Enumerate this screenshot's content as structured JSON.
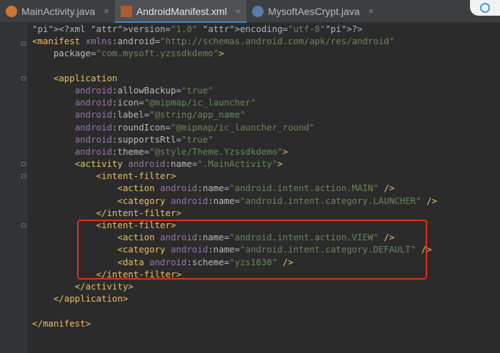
{
  "tabs": [
    {
      "label": "MainActivity.java",
      "icon": "java-file-icon",
      "active": false
    },
    {
      "label": "AndroidManifest.xml",
      "icon": "xml-file-icon",
      "active": true
    },
    {
      "label": "MysoftAesCrypt.java",
      "icon": "java-file-icon",
      "active": false
    }
  ],
  "tab_close_glyph": "×",
  "code_lines": [
    {
      "indent": 0,
      "text": "<?xml version=\"1.0\" encoding=\"utf-8\"?>"
    },
    {
      "indent": 0,
      "text": "<manifest xmlns:android=\"http://schemas.android.com/apk/res/android\""
    },
    {
      "indent": 4,
      "text": "package=\"com.mysoft.yzssdkdemo\">"
    },
    {
      "indent": 0,
      "text": ""
    },
    {
      "indent": 4,
      "text": "<application"
    },
    {
      "indent": 8,
      "text": "android:allowBackup=\"true\""
    },
    {
      "indent": 8,
      "text": "android:icon=\"@mipmap/ic_launcher\""
    },
    {
      "indent": 8,
      "text": "android:label=\"@string/app_name\""
    },
    {
      "indent": 8,
      "text": "android:roundIcon=\"@mipmap/ic_launcher_round\""
    },
    {
      "indent": 8,
      "text": "android:supportsRtl=\"true\""
    },
    {
      "indent": 8,
      "text": "android:theme=\"@style/Theme.Yzssdkdemo\">"
    },
    {
      "indent": 8,
      "text": "<activity android:name=\".MainActivity\">"
    },
    {
      "indent": 12,
      "text": "<intent-filter>"
    },
    {
      "indent": 16,
      "text": "<action android:name=\"android.intent.action.MAIN\" />"
    },
    {
      "indent": 16,
      "text": "<category android:name=\"android.intent.category.LAUNCHER\" />"
    },
    {
      "indent": 12,
      "text": "</intent-filter>"
    },
    {
      "indent": 12,
      "text": "<intent-filter>"
    },
    {
      "indent": 16,
      "text": "<action android:name=\"android.intent.action.VIEW\" />"
    },
    {
      "indent": 16,
      "text": "<category android:name=\"android.intent.category.DEFAULT\" />"
    },
    {
      "indent": 16,
      "text": "<data android:scheme=\"yzs1030\" />"
    },
    {
      "indent": 12,
      "text": "</intent-filter>"
    },
    {
      "indent": 8,
      "text": "</activity>"
    },
    {
      "indent": 4,
      "text": "</application>"
    },
    {
      "indent": 0,
      "text": ""
    },
    {
      "indent": 0,
      "text": "</manifest>"
    }
  ],
  "highlight_color": "#e0301e",
  "accent": "#4a88c7"
}
